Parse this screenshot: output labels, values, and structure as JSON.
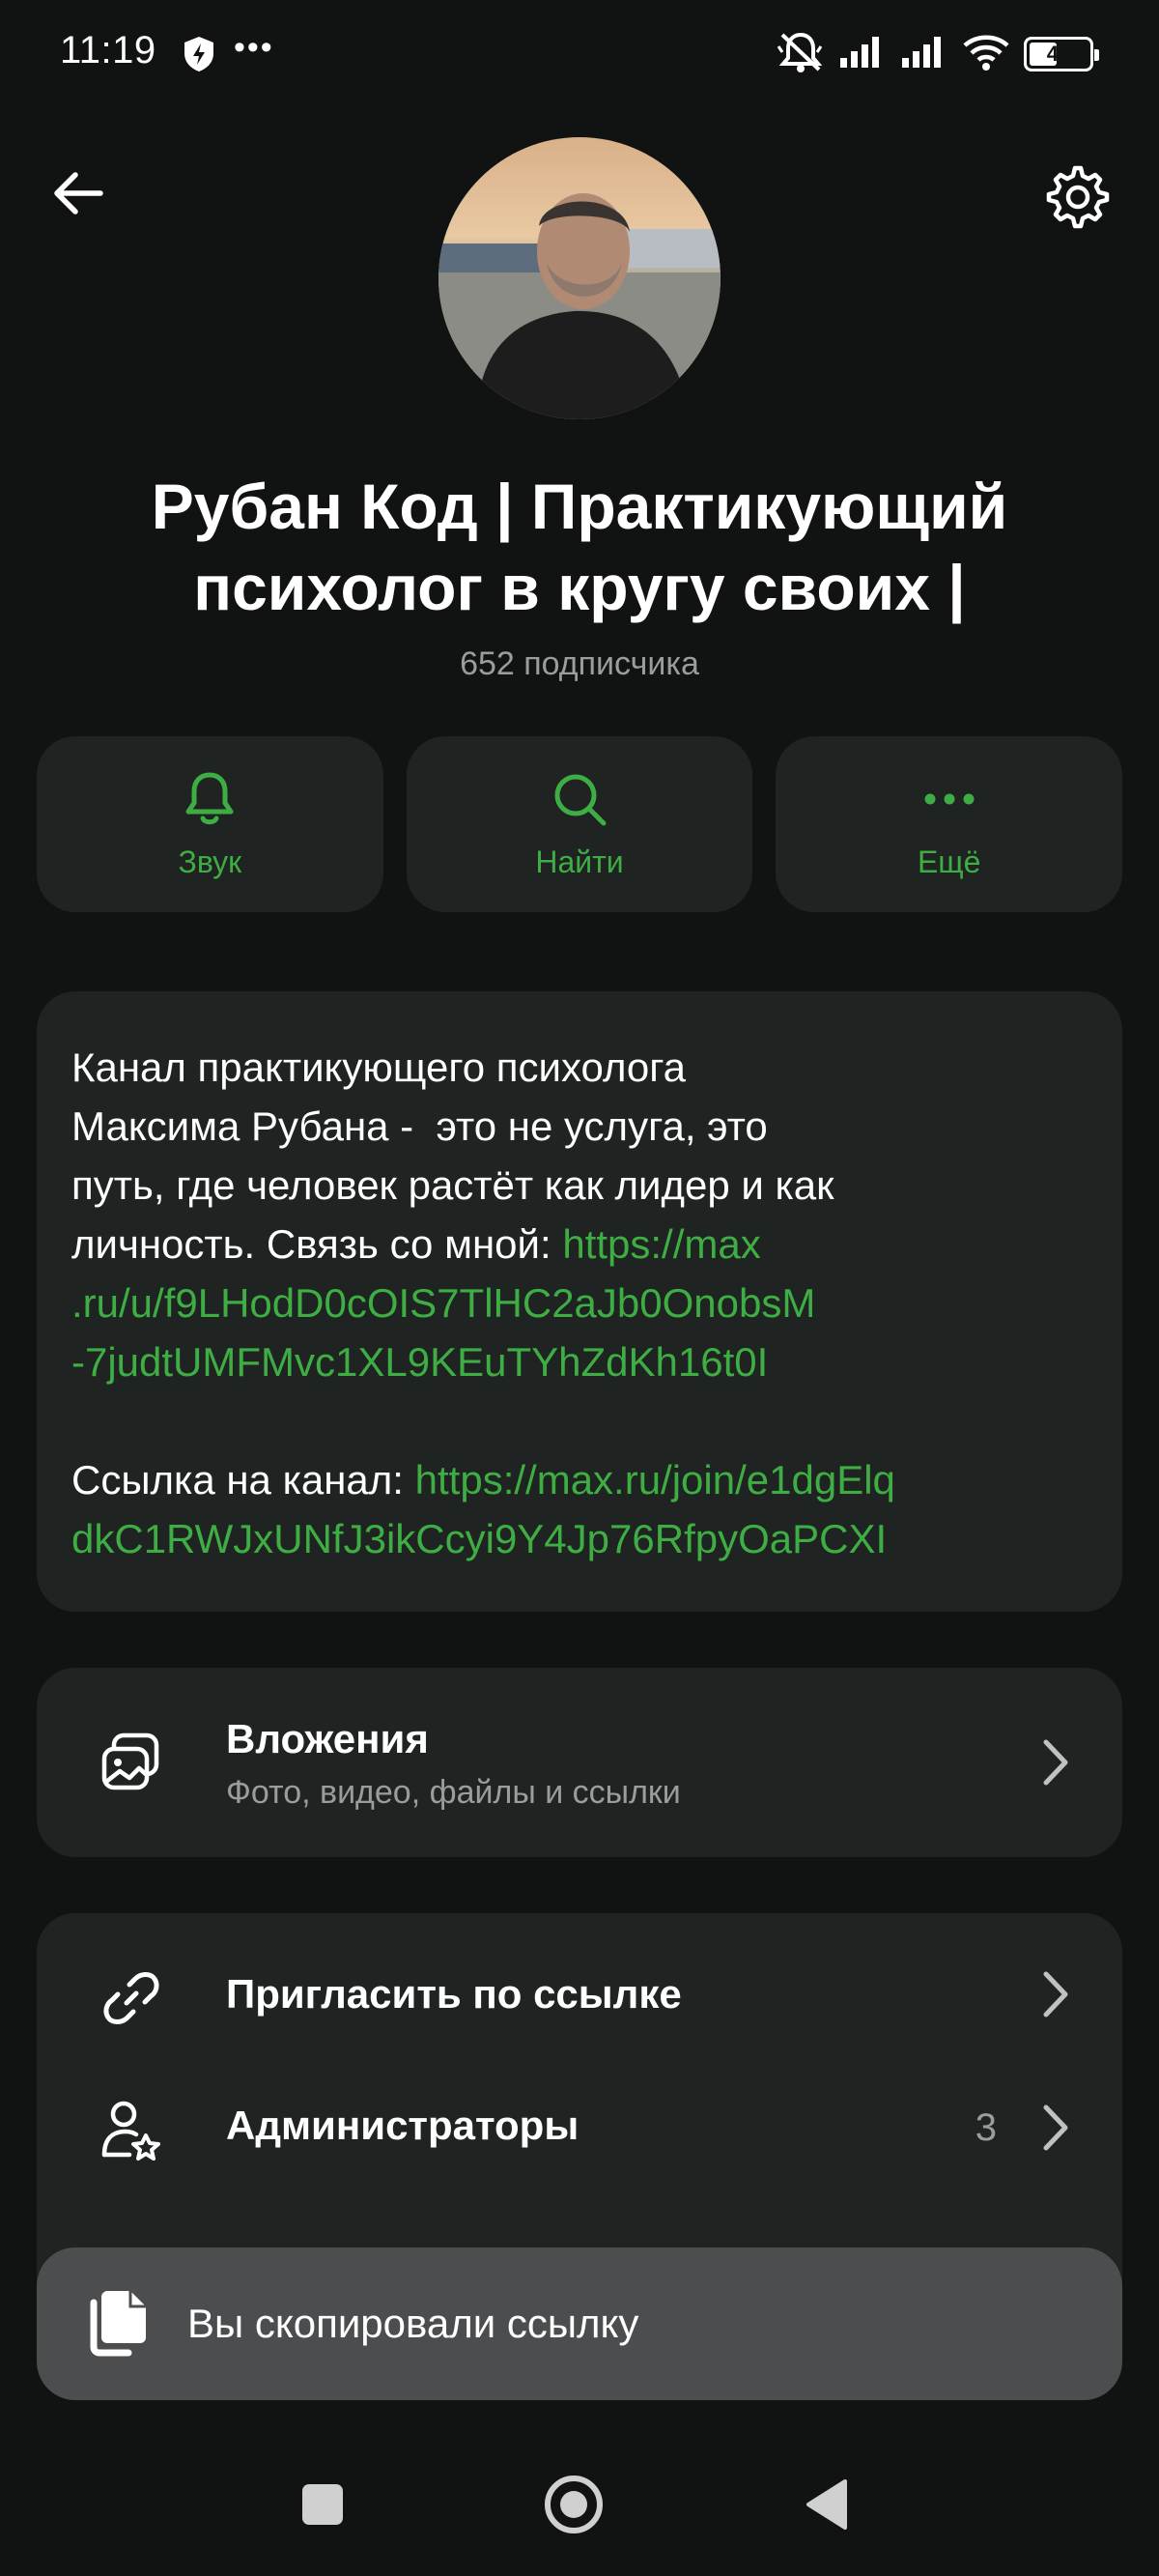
{
  "status_bar": {
    "time": "11:19",
    "overflow": "•••",
    "battery": "47",
    "battery_level": 0.47,
    "icons": [
      "shield-bolt-icon",
      "mute-icon",
      "signal-icon",
      "signal-icon",
      "wifi-icon",
      "battery-icon"
    ]
  },
  "header": {
    "back_icon": "arrow-left-icon",
    "settings_icon": "gear-icon"
  },
  "profile": {
    "title_line1": "Рубан Код | Практикующий",
    "title_line2": "психолог в кругу своих |",
    "subscribers": "652 подписчика"
  },
  "actions": [
    {
      "label": "Звук",
      "icon": "bell-icon"
    },
    {
      "label": "Найти",
      "icon": "search-icon"
    },
    {
      "label": "Ещё",
      "icon": "more-dots-icon"
    }
  ],
  "description": {
    "line1": "Канал практикующего психолога",
    "line2": "Максима Рубана -  это не услуга, это",
    "line3": "путь, где человек растёт как лидер и как",
    "line4_text": "личность. Связь со мной: ",
    "line4_link": "https://max",
    "line5_link": ".ru/u/f9LHodD0cOIS7TlHC2aJb0OnobsM",
    "line6_link": "-7judtUMFMvc1XL9KEuTYhZdKh16t0I",
    "line8_text": "Ссылка на канал: ",
    "line8_link": "https://max.ru/join/e1dgElq",
    "line9_link": "dkC1RWJxUNfJ3ikCcyi9Y4Jp76RfpyOaPCXI"
  },
  "attachments": {
    "title": "Вложения",
    "subtitle": "Фото, видео, файлы и ссылки",
    "icon": "gallery-icon"
  },
  "menu": {
    "invite": {
      "label": "Пригласить по ссылке",
      "icon": "link-icon"
    },
    "admins": {
      "label": "Администраторы",
      "count": "3",
      "icon": "user-star-icon"
    }
  },
  "toast": {
    "text": "Вы скопировали ссылку",
    "icon": "copy-icon"
  },
  "colors": {
    "accent": "#3eae44",
    "background": "#111312",
    "card": "#1f2321",
    "toast": "#4b4d4f"
  }
}
